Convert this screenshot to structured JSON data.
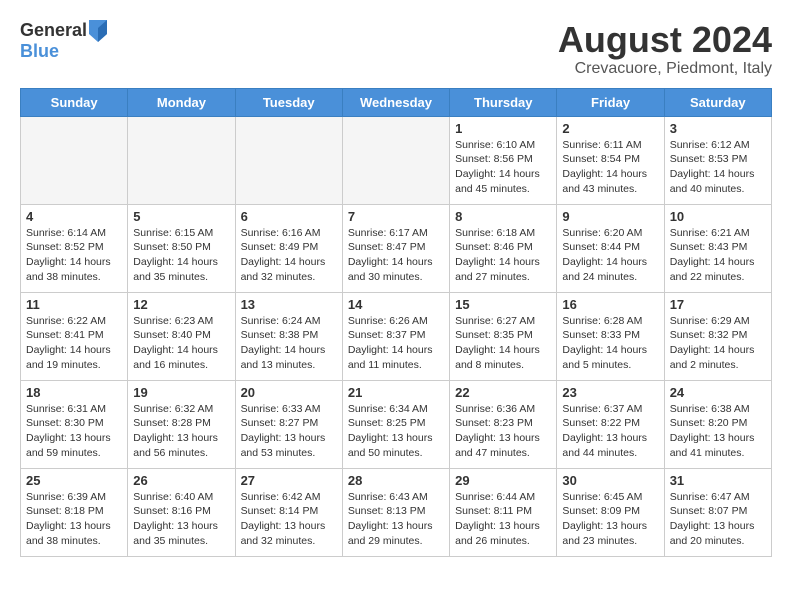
{
  "header": {
    "logo_general": "General",
    "logo_blue": "Blue",
    "month_year": "August 2024",
    "location": "Crevacuore, Piedmont, Italy"
  },
  "days_of_week": [
    "Sunday",
    "Monday",
    "Tuesday",
    "Wednesday",
    "Thursday",
    "Friday",
    "Saturday"
  ],
  "weeks": [
    [
      {
        "day": "",
        "info": "",
        "empty": true
      },
      {
        "day": "",
        "info": "",
        "empty": true
      },
      {
        "day": "",
        "info": "",
        "empty": true
      },
      {
        "day": "",
        "info": "",
        "empty": true
      },
      {
        "day": "1",
        "info": "Sunrise: 6:10 AM\nSunset: 8:56 PM\nDaylight: 14 hours\nand 45 minutes.",
        "empty": false
      },
      {
        "day": "2",
        "info": "Sunrise: 6:11 AM\nSunset: 8:54 PM\nDaylight: 14 hours\nand 43 minutes.",
        "empty": false
      },
      {
        "day": "3",
        "info": "Sunrise: 6:12 AM\nSunset: 8:53 PM\nDaylight: 14 hours\nand 40 minutes.",
        "empty": false
      }
    ],
    [
      {
        "day": "4",
        "info": "Sunrise: 6:14 AM\nSunset: 8:52 PM\nDaylight: 14 hours\nand 38 minutes.",
        "empty": false
      },
      {
        "day": "5",
        "info": "Sunrise: 6:15 AM\nSunset: 8:50 PM\nDaylight: 14 hours\nand 35 minutes.",
        "empty": false
      },
      {
        "day": "6",
        "info": "Sunrise: 6:16 AM\nSunset: 8:49 PM\nDaylight: 14 hours\nand 32 minutes.",
        "empty": false
      },
      {
        "day": "7",
        "info": "Sunrise: 6:17 AM\nSunset: 8:47 PM\nDaylight: 14 hours\nand 30 minutes.",
        "empty": false
      },
      {
        "day": "8",
        "info": "Sunrise: 6:18 AM\nSunset: 8:46 PM\nDaylight: 14 hours\nand 27 minutes.",
        "empty": false
      },
      {
        "day": "9",
        "info": "Sunrise: 6:20 AM\nSunset: 8:44 PM\nDaylight: 14 hours\nand 24 minutes.",
        "empty": false
      },
      {
        "day": "10",
        "info": "Sunrise: 6:21 AM\nSunset: 8:43 PM\nDaylight: 14 hours\nand 22 minutes.",
        "empty": false
      }
    ],
    [
      {
        "day": "11",
        "info": "Sunrise: 6:22 AM\nSunset: 8:41 PM\nDaylight: 14 hours\nand 19 minutes.",
        "empty": false
      },
      {
        "day": "12",
        "info": "Sunrise: 6:23 AM\nSunset: 8:40 PM\nDaylight: 14 hours\nand 16 minutes.",
        "empty": false
      },
      {
        "day": "13",
        "info": "Sunrise: 6:24 AM\nSunset: 8:38 PM\nDaylight: 14 hours\nand 13 minutes.",
        "empty": false
      },
      {
        "day": "14",
        "info": "Sunrise: 6:26 AM\nSunset: 8:37 PM\nDaylight: 14 hours\nand 11 minutes.",
        "empty": false
      },
      {
        "day": "15",
        "info": "Sunrise: 6:27 AM\nSunset: 8:35 PM\nDaylight: 14 hours\nand 8 minutes.",
        "empty": false
      },
      {
        "day": "16",
        "info": "Sunrise: 6:28 AM\nSunset: 8:33 PM\nDaylight: 14 hours\nand 5 minutes.",
        "empty": false
      },
      {
        "day": "17",
        "info": "Sunrise: 6:29 AM\nSunset: 8:32 PM\nDaylight: 14 hours\nand 2 minutes.",
        "empty": false
      }
    ],
    [
      {
        "day": "18",
        "info": "Sunrise: 6:31 AM\nSunset: 8:30 PM\nDaylight: 13 hours\nand 59 minutes.",
        "empty": false
      },
      {
        "day": "19",
        "info": "Sunrise: 6:32 AM\nSunset: 8:28 PM\nDaylight: 13 hours\nand 56 minutes.",
        "empty": false
      },
      {
        "day": "20",
        "info": "Sunrise: 6:33 AM\nSunset: 8:27 PM\nDaylight: 13 hours\nand 53 minutes.",
        "empty": false
      },
      {
        "day": "21",
        "info": "Sunrise: 6:34 AM\nSunset: 8:25 PM\nDaylight: 13 hours\nand 50 minutes.",
        "empty": false
      },
      {
        "day": "22",
        "info": "Sunrise: 6:36 AM\nSunset: 8:23 PM\nDaylight: 13 hours\nand 47 minutes.",
        "empty": false
      },
      {
        "day": "23",
        "info": "Sunrise: 6:37 AM\nSunset: 8:22 PM\nDaylight: 13 hours\nand 44 minutes.",
        "empty": false
      },
      {
        "day": "24",
        "info": "Sunrise: 6:38 AM\nSunset: 8:20 PM\nDaylight: 13 hours\nand 41 minutes.",
        "empty": false
      }
    ],
    [
      {
        "day": "25",
        "info": "Sunrise: 6:39 AM\nSunset: 8:18 PM\nDaylight: 13 hours\nand 38 minutes.",
        "empty": false
      },
      {
        "day": "26",
        "info": "Sunrise: 6:40 AM\nSunset: 8:16 PM\nDaylight: 13 hours\nand 35 minutes.",
        "empty": false
      },
      {
        "day": "27",
        "info": "Sunrise: 6:42 AM\nSunset: 8:14 PM\nDaylight: 13 hours\nand 32 minutes.",
        "empty": false
      },
      {
        "day": "28",
        "info": "Sunrise: 6:43 AM\nSunset: 8:13 PM\nDaylight: 13 hours\nand 29 minutes.",
        "empty": false
      },
      {
        "day": "29",
        "info": "Sunrise: 6:44 AM\nSunset: 8:11 PM\nDaylight: 13 hours\nand 26 minutes.",
        "empty": false
      },
      {
        "day": "30",
        "info": "Sunrise: 6:45 AM\nSunset: 8:09 PM\nDaylight: 13 hours\nand 23 minutes.",
        "empty": false
      },
      {
        "day": "31",
        "info": "Sunrise: 6:47 AM\nSunset: 8:07 PM\nDaylight: 13 hours\nand 20 minutes.",
        "empty": false
      }
    ]
  ]
}
